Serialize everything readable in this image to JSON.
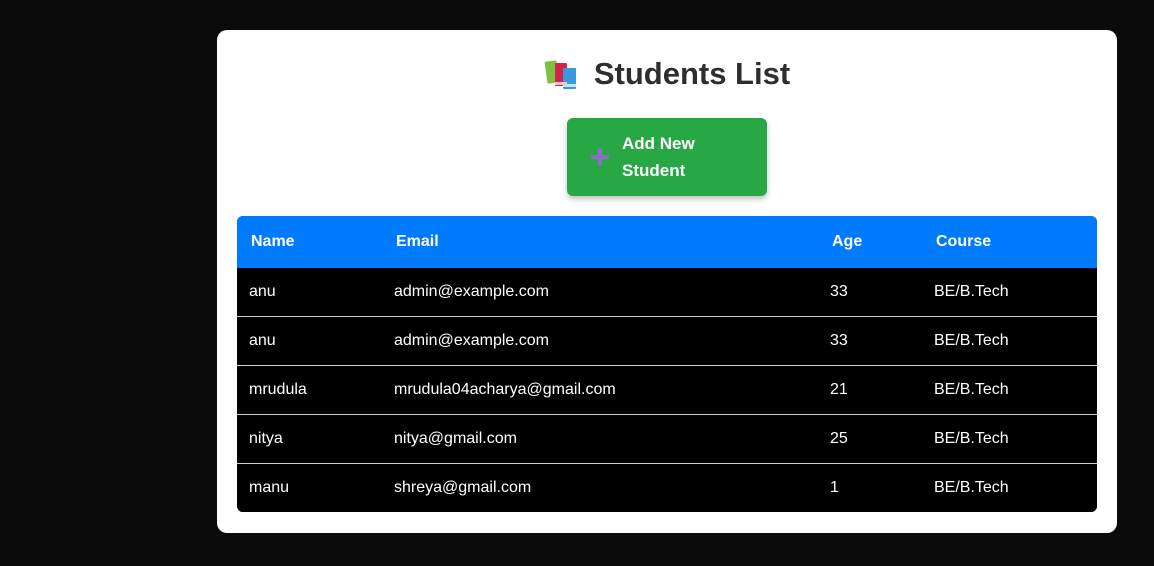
{
  "page": {
    "title": "Students List",
    "title_icon": "books-icon",
    "accent_color": "#007bff",
    "button_color": "#28a745"
  },
  "actions": {
    "add_student_label": "Add New Student",
    "add_icon": "plus-icon"
  },
  "table": {
    "columns": [
      "Name",
      "Email",
      "Age",
      "Course"
    ],
    "rows": [
      {
        "name": "anu",
        "email": "admin@example.com",
        "age": "33",
        "course": "BE/B.Tech"
      },
      {
        "name": "anu",
        "email": "admin@example.com",
        "age": "33",
        "course": "BE/B.Tech"
      },
      {
        "name": "mrudula",
        "email": "mrudula04acharya@gmail.com",
        "age": "21",
        "course": "BE/B.Tech"
      },
      {
        "name": "nitya",
        "email": "nitya@gmail.com",
        "age": "25",
        "course": "BE/B.Tech"
      },
      {
        "name": "manu",
        "email": "shreya@gmail.com",
        "age": "1",
        "course": "BE/B.Tech"
      }
    ]
  }
}
